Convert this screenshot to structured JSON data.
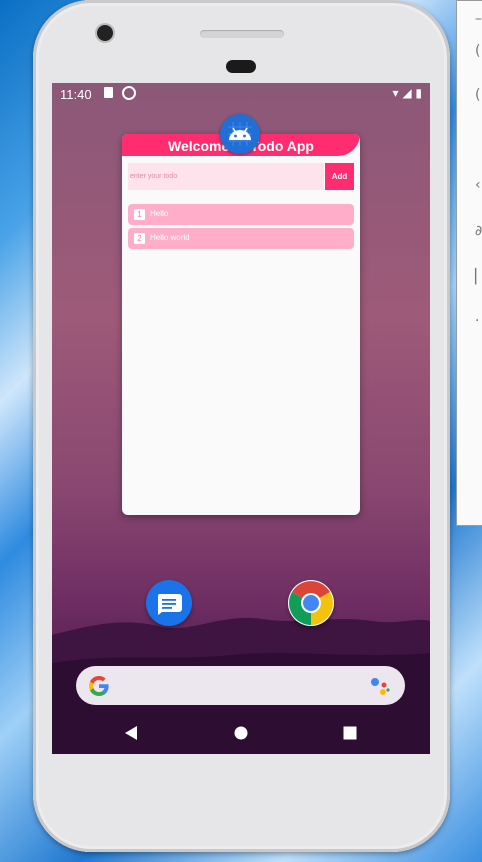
{
  "status_bar": {
    "time": "11:40"
  },
  "app": {
    "title": "Welcome to Todo App",
    "input_placeholder": "enter your todo",
    "add_label": "Add",
    "todos": [
      {
        "num": "1",
        "text": "Hello"
      },
      {
        "num": "2",
        "text": "Hello world"
      }
    ]
  },
  "home": {
    "dock": [
      "messages-app-icon",
      "chrome-app-icon"
    ],
    "search_logo": "G"
  },
  "colors": {
    "accent": "#ff2d6f",
    "input_bg": "#ffe3ec",
    "item_bg": "#ffadc8"
  }
}
